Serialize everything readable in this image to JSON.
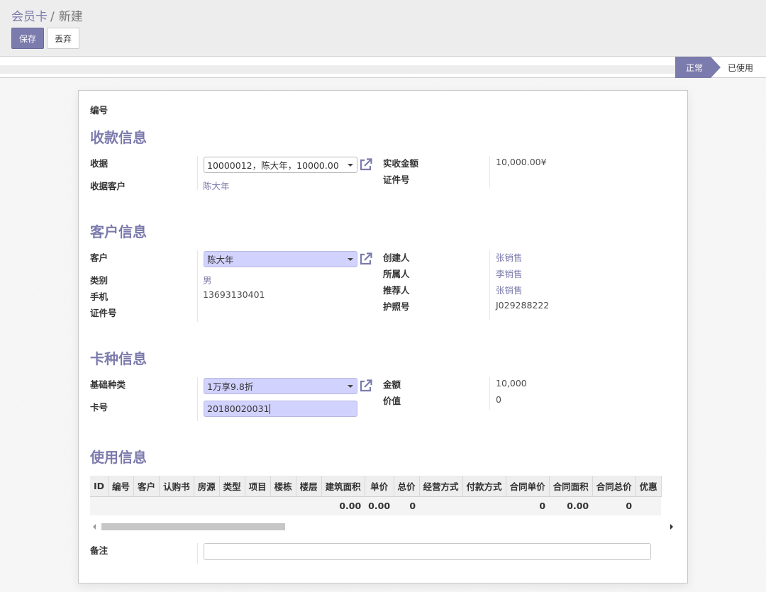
{
  "breadcrumb": {
    "parent": "会员卡",
    "separator": "/",
    "current": "新建"
  },
  "buttons": {
    "save": "保存",
    "discard": "丢弃"
  },
  "status": {
    "active": "正常",
    "other": "已使用"
  },
  "form": {
    "code_label": "编号",
    "payment": {
      "title": "收款信息",
      "receipt_label": "收据",
      "receipt_value": "10000012，陈大年，10000.00",
      "receipt_customer_label": "收据客户",
      "receipt_customer_value": "陈大年",
      "actual_amount_label": "实收金额",
      "actual_amount_value": "10,000.00¥",
      "id_number_label": "证件号",
      "id_number_value": ""
    },
    "customer": {
      "title": "客户信息",
      "customer_label": "客户",
      "customer_value": "陈大年",
      "category_label": "类别",
      "category_value": "男",
      "phone_label": "手机",
      "phone_value": "13693130401",
      "id_label": "证件号",
      "id_value": "",
      "creator_label": "创建人",
      "creator_value": "张销售",
      "owner_label": "所属人",
      "owner_value": "李销售",
      "referrer_label": "推荐人",
      "referrer_value": "张销售",
      "passport_label": "护照号",
      "passport_value": "J029288222"
    },
    "card": {
      "title": "卡种信息",
      "type_label": "基础种类",
      "type_value": "1万享9.8折",
      "number_label": "卡号",
      "number_value": "20180020031",
      "amount_label": "金额",
      "amount_value": "10,000",
      "worth_label": "价值",
      "worth_value": "0"
    },
    "usage": {
      "title": "使用信息",
      "columns": [
        "ID",
        "编号",
        "客户",
        "认购书",
        "房源",
        "类型",
        "项目",
        "楼栋",
        "楼层",
        "建筑面积",
        "单价",
        "总价",
        "经营方式",
        "付款方式",
        "合同单价",
        "合同面积",
        "合同总价",
        "优惠"
      ],
      "totals": [
        "",
        "",
        "",
        "",
        "",
        "",
        "",
        "",
        "",
        "0.00",
        "0.00",
        "0",
        "",
        "",
        "0",
        "0.00",
        "0",
        ""
      ]
    },
    "notes": {
      "label": "备注",
      "value": ""
    }
  },
  "icons": [
    "external-link-icon",
    "caret-down-icon",
    "scroll-left-icon",
    "scroll-right-icon"
  ],
  "colors": {
    "accent": "#7c7bad",
    "required_field": "#d2d2ff"
  }
}
